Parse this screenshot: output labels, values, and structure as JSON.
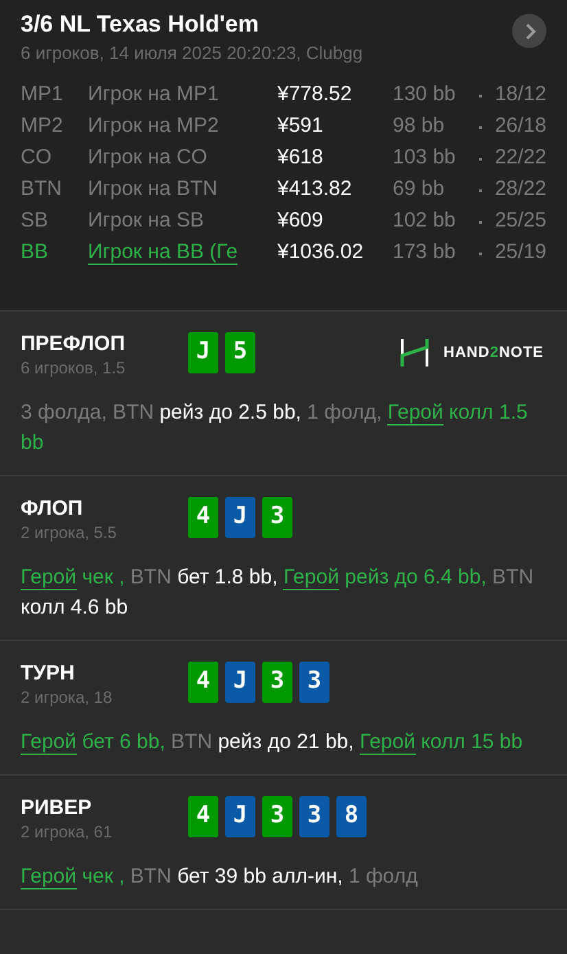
{
  "header": {
    "title": "3/6 NL Texas Hold'em",
    "subtitle": "6 игроков, 14 июля 2025 20:20:23, Clubgg"
  },
  "players": [
    {
      "position": "MP1",
      "name": "Игрок на MP1",
      "stack": "¥778.52",
      "bb": "130 bb",
      "stats": "18/12",
      "hero": false
    },
    {
      "position": "MP2",
      "name": "Игрок на MP2",
      "stack": "¥591",
      "bb": "98 bb",
      "stats": "26/18",
      "hero": false
    },
    {
      "position": "CO",
      "name": "Игрок на CO",
      "stack": "¥618",
      "bb": "103 bb",
      "stats": "22/22",
      "hero": false
    },
    {
      "position": "BTN",
      "name": "Игрок на BTN",
      "stack": "¥413.82",
      "bb": "69 bb",
      "stats": "28/22",
      "hero": false
    },
    {
      "position": "SB",
      "name": "Игрок на SB",
      "stack": "¥609",
      "bb": "102 bb",
      "stats": "25/25",
      "hero": false
    },
    {
      "position": "BB",
      "name": "Игрок на BB (Ге",
      "stack": "¥1036.02",
      "bb": "173 bb",
      "stats": "25/19",
      "hero": true
    }
  ],
  "logo": [
    "HAND",
    "2",
    "NOTE"
  ],
  "streets": [
    {
      "title": "ПРЕФЛОП",
      "subtitle": "6 игроков, 1.5",
      "cards": [
        {
          "rank": "J",
          "color": "#009a00"
        },
        {
          "rank": "5",
          "color": "#009a00"
        }
      ],
      "logo": true,
      "actions": [
        {
          "kind": "muted",
          "text": "3 фолда, BTN "
        },
        {
          "kind": "plain",
          "text": "рейз до 2.5 bb, "
        },
        {
          "kind": "muted",
          "text": "1 фолд, "
        },
        {
          "kind": "hero-link",
          "text": "Герой"
        },
        {
          "kind": "hero",
          "text": " колл 1.5 bb"
        }
      ]
    },
    {
      "title": "ФЛОП",
      "subtitle": "2 игрока, 5.5",
      "cards": [
        {
          "rank": "4",
          "color": "#009a00"
        },
        {
          "rank": "J",
          "color": "#0a5aa8"
        },
        {
          "rank": "3",
          "color": "#009a00"
        }
      ],
      "logo": false,
      "actions": [
        {
          "kind": "hero-link",
          "text": "Герой"
        },
        {
          "kind": "hero",
          "text": " чек , "
        },
        {
          "kind": "muted",
          "text": "BTN "
        },
        {
          "kind": "plain",
          "text": "бет 1.8 bb, "
        },
        {
          "kind": "hero-link",
          "text": "Герой"
        },
        {
          "kind": "hero",
          "text": " рейз до 6.4 bb, "
        },
        {
          "kind": "muted",
          "text": "BTN "
        },
        {
          "kind": "plain",
          "text": "колл 4.6 bb"
        }
      ]
    },
    {
      "title": "ТУРН",
      "subtitle": "2 игрока, 18",
      "cards": [
        {
          "rank": "4",
          "color": "#009a00"
        },
        {
          "rank": "J",
          "color": "#0a5aa8"
        },
        {
          "rank": "3",
          "color": "#009a00"
        },
        {
          "rank": "3",
          "color": "#0a5aa8"
        }
      ],
      "logo": false,
      "actions": [
        {
          "kind": "hero-link",
          "text": "Герой"
        },
        {
          "kind": "hero",
          "text": " бет 6 bb, "
        },
        {
          "kind": "muted",
          "text": "BTN "
        },
        {
          "kind": "plain",
          "text": "рейз до 21 bb, "
        },
        {
          "kind": "hero-link",
          "text": "Герой"
        },
        {
          "kind": "hero",
          "text": " колл 15 bb"
        }
      ]
    },
    {
      "title": "РИВЕР",
      "subtitle": "2 игрока, 61",
      "cards": [
        {
          "rank": "4",
          "color": "#009a00"
        },
        {
          "rank": "J",
          "color": "#0a5aa8"
        },
        {
          "rank": "3",
          "color": "#009a00"
        },
        {
          "rank": "3",
          "color": "#0a5aa8"
        },
        {
          "rank": "8",
          "color": "#0a5aa8"
        }
      ],
      "logo": false,
      "actions": [
        {
          "kind": "hero-link",
          "text": "Герой"
        },
        {
          "kind": "hero",
          "text": " чек , "
        },
        {
          "kind": "muted",
          "text": "BTN "
        },
        {
          "kind": "plain",
          "text": "бет 39 bb алл-ин, "
        },
        {
          "kind": "muted",
          "text": "1 фолд"
        }
      ]
    }
  ]
}
